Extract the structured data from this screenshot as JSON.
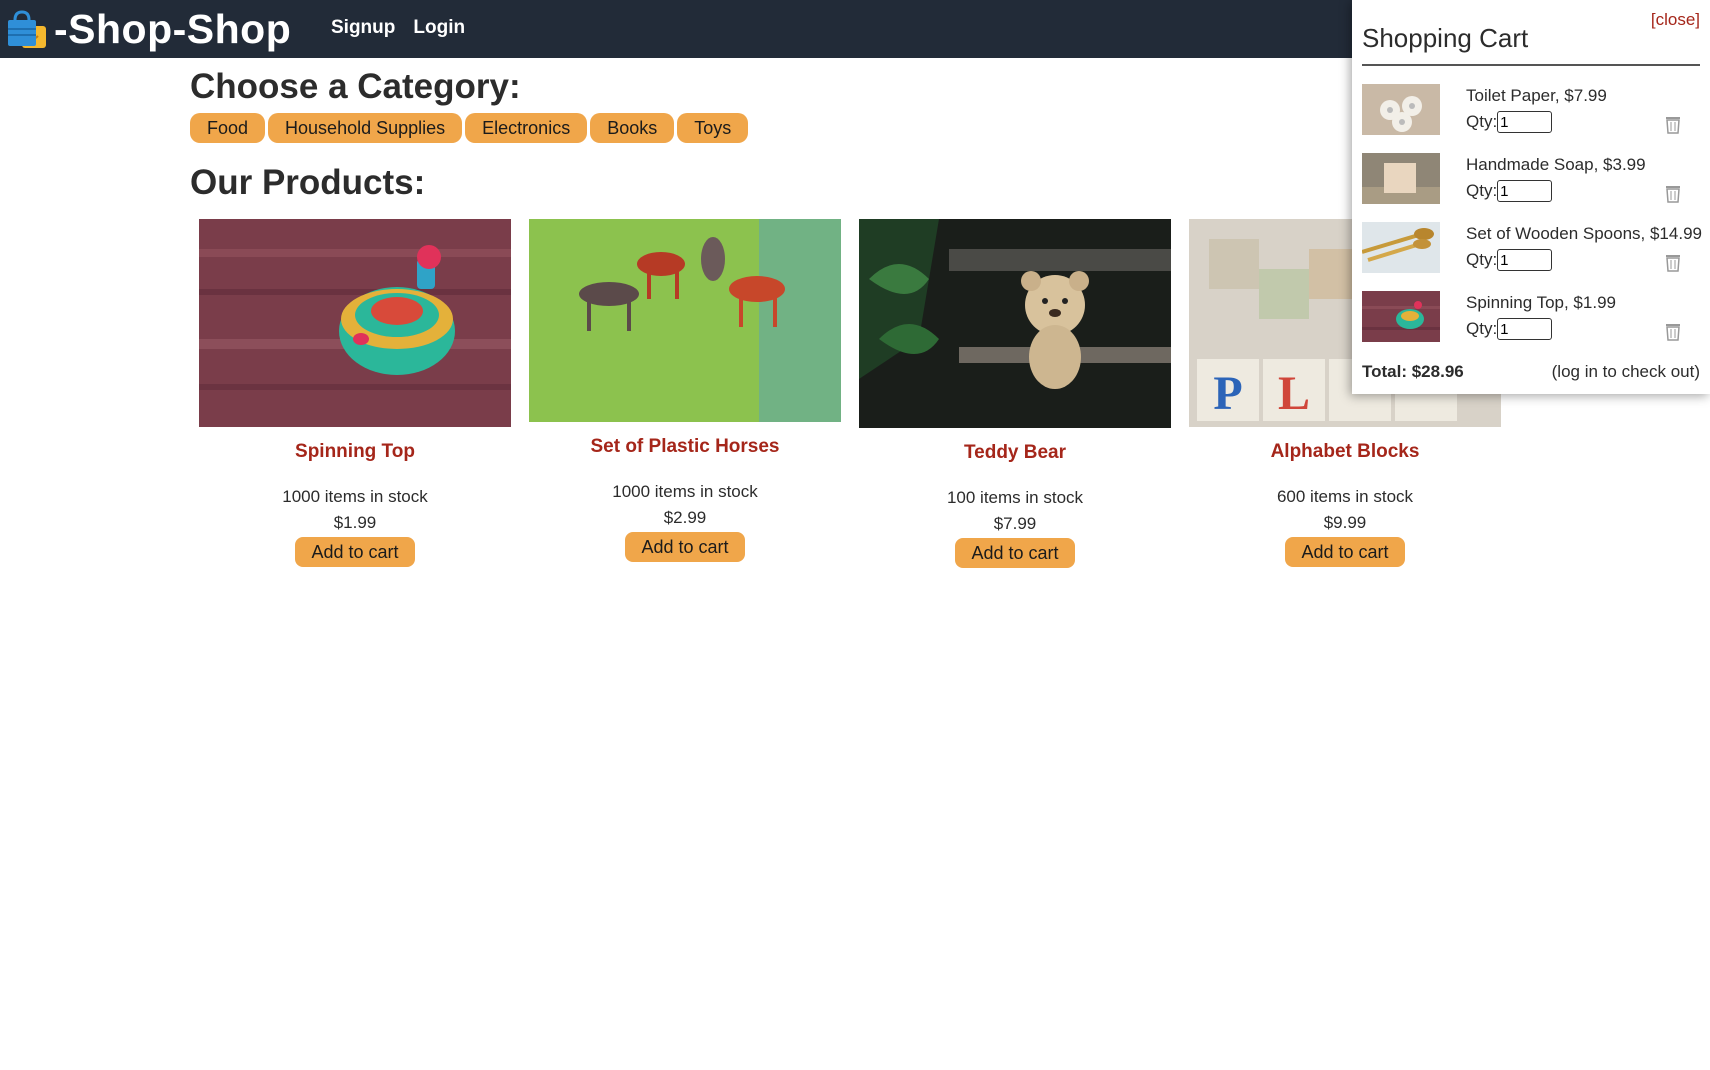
{
  "header": {
    "brand": "-Shop-Shop",
    "nav": [
      "Signup",
      "Login"
    ]
  },
  "categories": {
    "title": "Choose a Category:",
    "items": [
      "Food",
      "Household Supplies",
      "Electronics",
      "Books",
      "Toys"
    ]
  },
  "products": {
    "title": "Our Products:",
    "items": [
      {
        "name": "Spinning Top",
        "stock": "1000 items in stock",
        "price": "$1.99",
        "button": "Add to cart"
      },
      {
        "name": "Set of Plastic Horses",
        "stock": "1000 items in stock",
        "price": "$2.99",
        "button": "Add to cart"
      },
      {
        "name": "Teddy Bear",
        "stock": "100 items in stock",
        "price": "$7.99",
        "button": "Add to cart"
      },
      {
        "name": "Alphabet Blocks",
        "stock": "600 items in stock",
        "price": "$9.99",
        "button": "Add to cart"
      }
    ]
  },
  "cart": {
    "close_label": "[close]",
    "title": "Shopping Cart",
    "qty_label": "Qty:",
    "items": [
      {
        "label": "Toilet Paper, $7.99",
        "qty": "1"
      },
      {
        "label": "Handmade Soap, $3.99",
        "qty": "1"
      },
      {
        "label": "Set of Wooden Spoons, $14.99",
        "qty": "1"
      },
      {
        "label": "Spinning Top, $1.99",
        "qty": "1"
      }
    ],
    "total": "Total: $28.96",
    "note": "(log in to check out)"
  },
  "colors": {
    "header_bg": "#222b38",
    "accent_button": "#f0a64a",
    "product_link": "#a5261a"
  }
}
